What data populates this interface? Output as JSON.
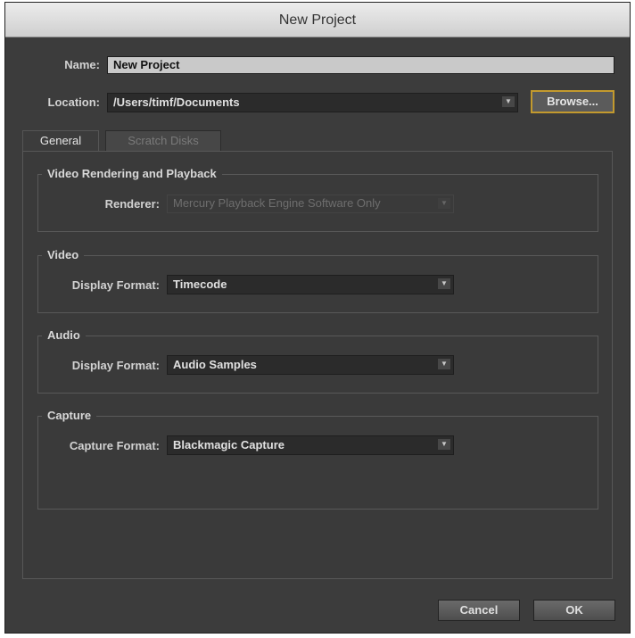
{
  "window": {
    "title": "New Project"
  },
  "project": {
    "name_label": "Name:",
    "name_value": "New Project",
    "location_label": "Location:",
    "location_value": "/Users/timf/Documents",
    "browse_label": "Browse..."
  },
  "tabs": [
    {
      "label": "General",
      "active": true
    },
    {
      "label": "Scratch Disks",
      "active": false
    }
  ],
  "sections": {
    "rendering": {
      "title": "Video Rendering and Playback",
      "renderer_label": "Renderer:",
      "renderer_value": "Mercury Playback Engine Software Only",
      "enabled": false
    },
    "video": {
      "title": "Video",
      "format_label": "Display Format:",
      "format_value": "Timecode"
    },
    "audio": {
      "title": "Audio",
      "format_label": "Display Format:",
      "format_value": "Audio Samples"
    },
    "capture": {
      "title": "Capture",
      "format_label": "Capture Format:",
      "format_value": "Blackmagic Capture"
    }
  },
  "buttons": {
    "cancel": "Cancel",
    "ok": "OK"
  },
  "icons": {
    "dropdown_arrow": "chevron-down-icon"
  },
  "colors": {
    "window_bg": "#3c3c3c",
    "highlight_border": "#c39a2e",
    "titlebar": "#dcdcdc"
  }
}
